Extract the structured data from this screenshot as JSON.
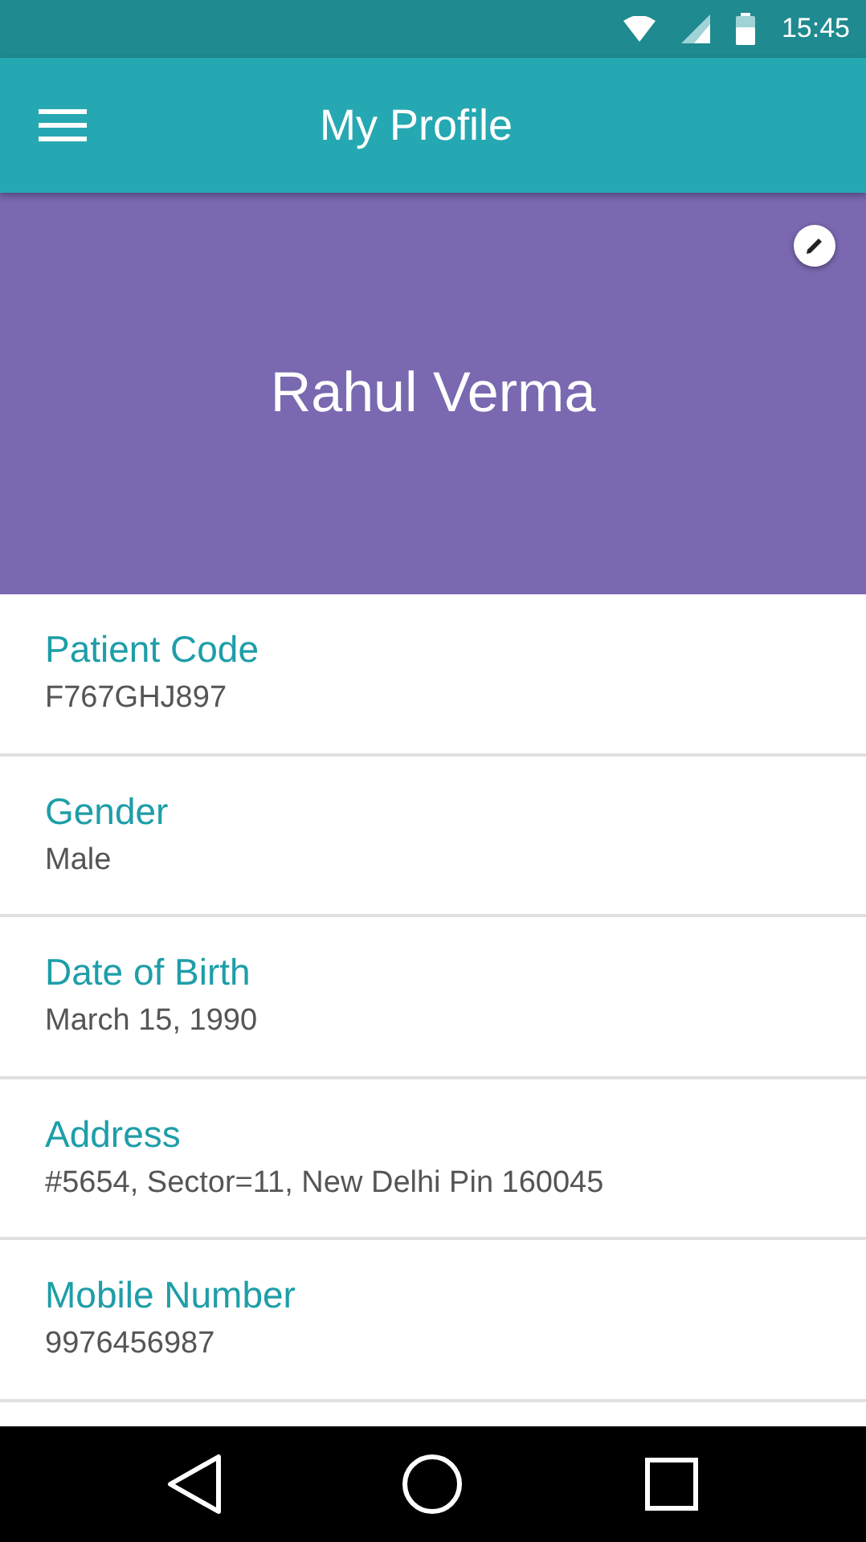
{
  "status_bar": {
    "time": "15:45"
  },
  "app_bar": {
    "title": "My Profile"
  },
  "profile": {
    "name": "Rahul Verma"
  },
  "fields": [
    {
      "label": "Patient Code",
      "value": "F767GHJ897"
    },
    {
      "label": "Gender",
      "value": "Male"
    },
    {
      "label": "Date of Birth",
      "value": "March 15, 1990"
    },
    {
      "label": "Address",
      "value": "#5654, Sector=11, New Delhi Pin 160045"
    },
    {
      "label": "Mobile Number",
      "value": "9976456987"
    }
  ]
}
